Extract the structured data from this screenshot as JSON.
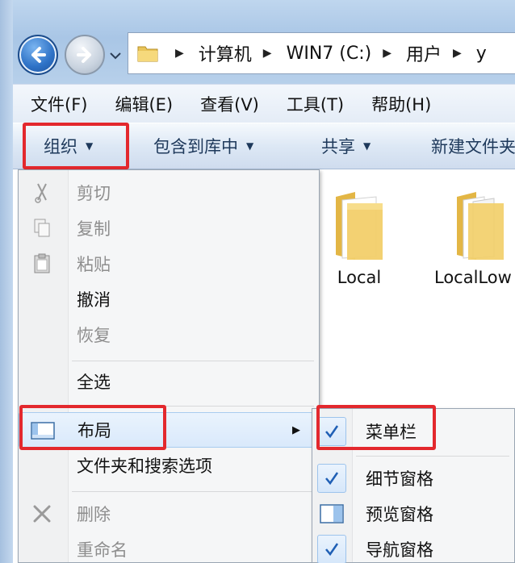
{
  "address": {
    "crumbs": [
      "计算机",
      "WIN7 (C:)",
      "用户",
      "y"
    ]
  },
  "menubar": {
    "items": [
      "文件(F)",
      "编辑(E)",
      "查看(V)",
      "工具(T)",
      "帮助(H)"
    ]
  },
  "commandbar": {
    "organize": "组织",
    "include_in_library": "包含到库中",
    "share": "共享",
    "new_folder": "新建文件夹"
  },
  "files": [
    {
      "name": "Local"
    },
    {
      "name": "LocalLow"
    }
  ],
  "organize_menu": {
    "items": [
      {
        "label": "剪切",
        "icon": "scissors-icon",
        "enabled": false
      },
      {
        "label": "复制",
        "icon": "copy-icon",
        "enabled": false
      },
      {
        "label": "粘贴",
        "icon": "paste-icon",
        "enabled": false
      },
      {
        "label": "撤消",
        "icon": "",
        "enabled": true
      },
      {
        "label": "恢复",
        "icon": "",
        "enabled": false
      },
      {
        "label": "全选",
        "icon": "",
        "enabled": true
      },
      {
        "label": "布局",
        "icon": "layout-icon",
        "enabled": true,
        "has_submenu": true
      },
      {
        "label": "文件夹和搜索选项",
        "icon": "",
        "enabled": true
      },
      {
        "label": "删除",
        "icon": "delete-icon",
        "enabled": false
      },
      {
        "label": "重命名",
        "icon": "",
        "enabled": false
      }
    ]
  },
  "layout_submenu": {
    "items": [
      {
        "label": "菜单栏",
        "checked": true
      },
      {
        "label": "细节窗格",
        "checked": true
      },
      {
        "label": "预览窗格",
        "checked": false
      },
      {
        "label": "导航窗格",
        "checked": true
      }
    ]
  },
  "colors": {
    "highlight_box": "#e3282d",
    "command_text": "#1e395b",
    "checkmark": "#1f5fb5"
  }
}
